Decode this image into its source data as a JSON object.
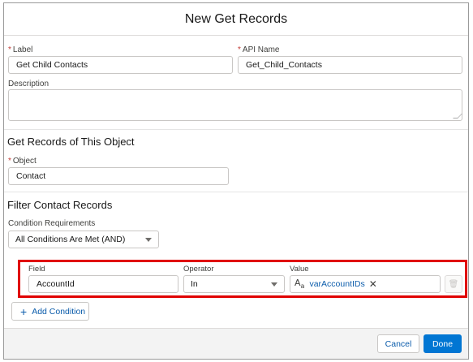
{
  "modal": {
    "title": "New Get Records"
  },
  "fields": {
    "label": {
      "label": "Label",
      "value": "Get Child Contacts",
      "required_marker": "*"
    },
    "api_name": {
      "label": "API Name",
      "value": "Get_Child_Contacts",
      "required_marker": "*"
    },
    "description": {
      "label": "Description",
      "value": ""
    }
  },
  "object_section": {
    "heading": "Get Records of This Object",
    "object": {
      "label": "Object",
      "value": "Contact",
      "required_marker": "*"
    }
  },
  "filter_section": {
    "heading": "Filter Contact Records",
    "condition_requirements": {
      "label": "Condition Requirements",
      "value": "All Conditions Are Met (AND)"
    },
    "condition_headers": {
      "field": "Field",
      "operator": "Operator",
      "value": "Value"
    },
    "condition": {
      "field": "AccountId",
      "operator": "In",
      "value_icon": "text-variable-icon",
      "value": "varAccountIDs"
    },
    "add_condition_label": "Add Condition"
  },
  "footer": {
    "cancel_label": "Cancel",
    "done_label": "Done"
  },
  "colors": {
    "highlight": "#e00000",
    "brand": "#0176d3",
    "link": "#0b5cab",
    "required": "#c23934"
  }
}
